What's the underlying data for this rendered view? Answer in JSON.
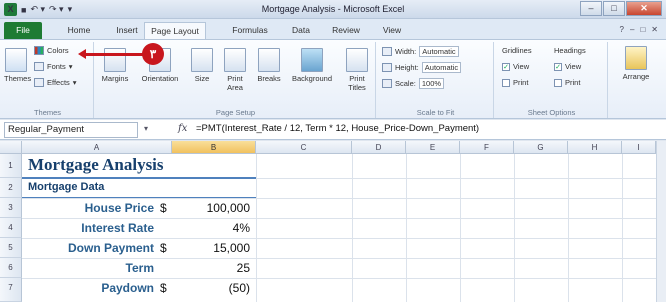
{
  "titlebar": {
    "title": "Mortgage Analysis - Microsoft Excel",
    "qat": {
      "logo": "X",
      "save": "■",
      "undo": "↶ ▾",
      "redo": "↷ ▾",
      "customize": "▾"
    },
    "window_buttons": {
      "minimize": "–",
      "maximize": "□",
      "close": "✕"
    }
  },
  "tabs": [
    {
      "label": "File"
    },
    {
      "label": "Home"
    },
    {
      "label": "Insert"
    },
    {
      "label": "Page Layout"
    },
    {
      "label": "Formulas"
    },
    {
      "label": "Data"
    },
    {
      "label": "Review"
    },
    {
      "label": "View"
    }
  ],
  "tab_icons": {
    "help": "?",
    "min": "–",
    "restore": "□",
    "close": "✕"
  },
  "ribbon": {
    "themes": {
      "group_label": "Themes",
      "themes_button": "Themes",
      "colors": "Colors",
      "fonts": "Fonts",
      "effects": "Effects"
    },
    "page_setup": {
      "group_label": "Page Setup",
      "buttons": [
        "Margins",
        "Orientation",
        "Size",
        "Print Area",
        "Breaks",
        "Background",
        "Print Titles"
      ]
    },
    "scale_to_fit": {
      "group_label": "Scale to Fit",
      "width_label": "Width:",
      "width_value": "Automatic",
      "height_label": "Height:",
      "height_value": "Automatic",
      "scale_label": "Scale:",
      "scale_value": "100%"
    },
    "sheet_options": {
      "group_label": "Sheet Options",
      "gridlines": "Gridlines",
      "headings": "Headings",
      "view": "View",
      "print": "Print"
    },
    "arrange": {
      "label": "Arrange"
    }
  },
  "callout": {
    "number": "٣"
  },
  "formula_bar": {
    "name_box": "Regular_Payment",
    "fx": "fx",
    "formula": "=PMT(Interest_Rate / 12, Term * 12, House_Price-Down_Payment)"
  },
  "columns": [
    "A",
    "B",
    "C",
    "D",
    "E",
    "F",
    "G",
    "H",
    "I"
  ],
  "rows": [
    "1",
    "2",
    "3",
    "4",
    "5",
    "6",
    "7"
  ],
  "cells": {
    "title": "Mortgage Analysis",
    "subtitle": "Mortgage Data",
    "house_price_label": "House Price",
    "house_price_currency": "$",
    "house_price_value": "100,000",
    "interest_rate_label": "Interest Rate",
    "interest_rate_value": "4%",
    "down_payment_label": "Down Payment",
    "down_payment_currency": "$",
    "down_payment_value": "15,000",
    "term_label": "Term",
    "term_value": "25",
    "paydown_label": "Paydown",
    "paydown_currency": "$",
    "paydown_value": "(50)"
  }
}
